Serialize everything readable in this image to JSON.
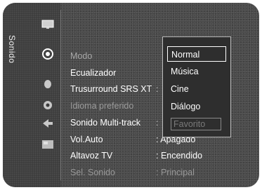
{
  "sidebar": {
    "title": "Sonido",
    "icons": [
      "picture-icon",
      "sound-icon",
      "channel-icon",
      "setup-icon",
      "input-icon",
      "application-icon"
    ]
  },
  "menu": {
    "items": [
      {
        "label": "Modo",
        "state": "selected"
      },
      {
        "label": "Ecualizador",
        "state": "enabled"
      },
      {
        "label": "Trusurround SRS XT",
        "state": "enabled"
      },
      {
        "label": "Idioma preferido",
        "state": "disabled"
      },
      {
        "label": "Sonido Multi-track",
        "state": "enabled"
      },
      {
        "label": "Vol.Auto",
        "state": "enabled",
        "value": ": Apagado"
      },
      {
        "label": "Altavoz TV",
        "state": "enabled",
        "value": ": Encendido"
      },
      {
        "label": "Sel. Sonido",
        "state": "disabled",
        "value": ": Principal"
      }
    ]
  },
  "dropdown": {
    "options": [
      {
        "label": "Normal",
        "state": "highlight"
      },
      {
        "label": "Música",
        "state": "enabled"
      },
      {
        "label": "Cine",
        "state": "enabled"
      },
      {
        "label": "Diálogo",
        "state": "enabled"
      },
      {
        "label": "Favorito",
        "state": "disabled"
      }
    ]
  }
}
